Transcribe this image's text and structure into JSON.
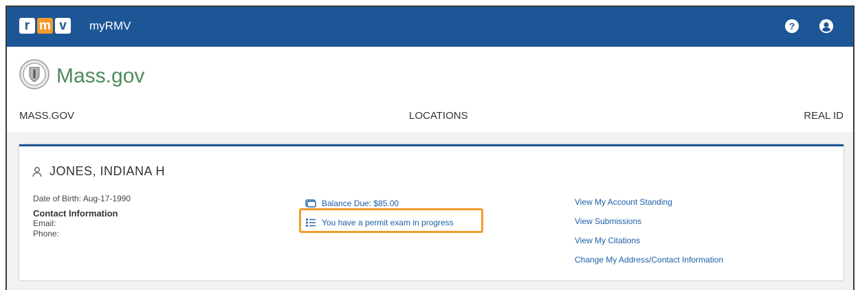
{
  "header": {
    "logo_letters": [
      "r",
      "m",
      "v"
    ],
    "app_title": "myRMV",
    "help_icon": "question-circle-icon",
    "account_icon": "user-circle-icon",
    "help_glyph": "?"
  },
  "mass_header": {
    "brand": "Mass.gov",
    "nav": [
      "MASS.GOV",
      "LOCATIONS",
      "REAL ID"
    ]
  },
  "profile": {
    "name": "JONES, INDIANA H",
    "dob": "Date of Birth: Aug-17-1990",
    "contact_heading": "Contact Information",
    "email_label": "Email:",
    "phone_label": "Phone:"
  },
  "alerts": {
    "balance": "Balance Due: $85.00",
    "permit": "You have a permit exam in progress"
  },
  "links": [
    "View My Account Standing",
    "View Submissions",
    "View My Citations",
    "Change My Address/Contact Information"
  ],
  "colors": {
    "brand_blue": "#1c5696",
    "link_blue": "#1c5fa8",
    "highlight_orange": "#f29b2c",
    "mass_green": "#4c8c5c"
  }
}
